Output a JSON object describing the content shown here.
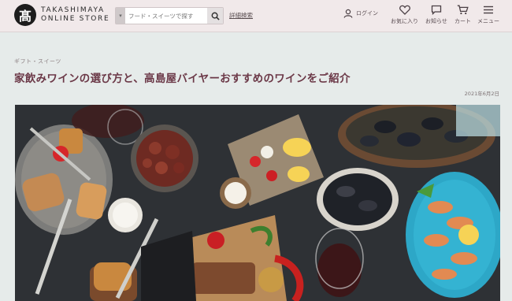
{
  "header": {
    "logo_mark": "髙",
    "logo_line1": "TAKASHIMAYA",
    "logo_line2": "ONLINE STORE",
    "search_placeholder": "フード・スイーツで探す",
    "detail_search": "詳細検索",
    "login": "ログイン",
    "favorites": "お気に入り",
    "notifications": "お知らせ",
    "cart": "カート",
    "menu": "メニュー"
  },
  "article": {
    "category": "ギフト・スイーツ",
    "title": "家飲みワインの選び方と、高島屋バイヤーおすすめのワインをご紹介",
    "date": "2021年6月2日"
  },
  "icons": {
    "search": "search-icon",
    "user": "user-icon",
    "heart": "heart-icon",
    "chat": "chat-bubble-icon",
    "cart": "cart-icon",
    "menu": "hamburger-menu-icon"
  },
  "colors": {
    "header_bg": "#f1e9ea",
    "title": "#6b3847",
    "page_bg": "#e6ebea"
  }
}
